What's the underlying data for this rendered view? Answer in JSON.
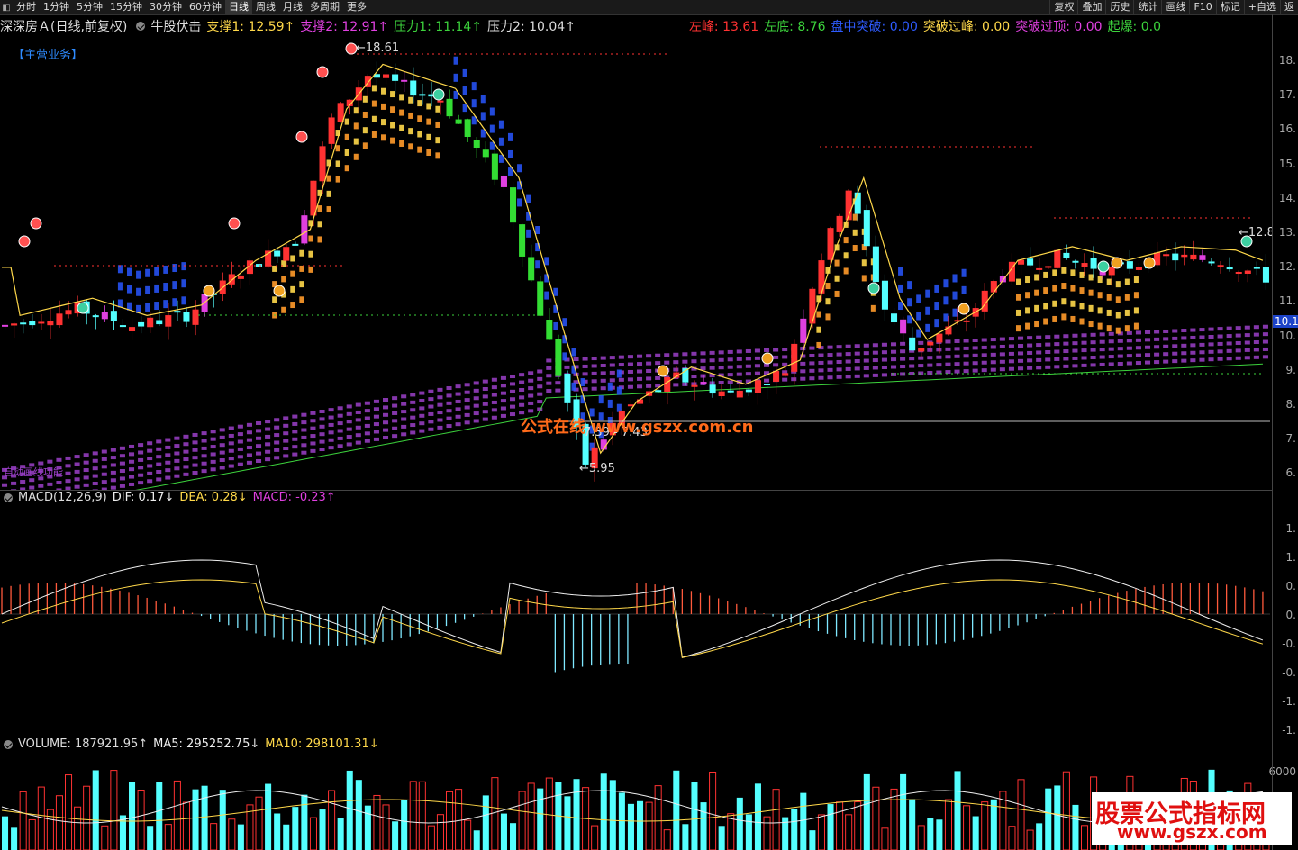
{
  "toolbar": {
    "tabs": [
      "分时",
      "1分钟",
      "5分钟",
      "15分钟",
      "30分钟",
      "60分钟",
      "日线",
      "周线",
      "月线",
      "多周期",
      "更多"
    ],
    "active_tab": "日线",
    "right_buttons": [
      "复权",
      "叠加",
      "历史",
      "统计",
      "画线",
      "F10",
      "标记",
      "+自选",
      "返"
    ]
  },
  "info": {
    "stock": "深深房Ａ(日线,前复权)",
    "indicator": "牛股伏击",
    "support1": "支撑1: 12.59↑",
    "support2": "支撑2: 12.91↑",
    "pressure1": "压力1: 11.14↑",
    "pressure2": "压力2: 10.04↑",
    "left_peak": "左峰: 13.61",
    "left_bottom": "左底: 8.76",
    "intraday_break": "盘中突破: 0.00",
    "break_peak": "突破过峰: 0.00",
    "break_top": "突破过顶: 0.00",
    "burst": "起爆: 0.0"
  },
  "main_business": "【主营业务】",
  "price_axis": [
    "18.",
    "17.",
    "16.",
    "15.",
    "14.",
    "13.",
    "12.",
    "11.",
    "10.",
    "9.",
    "8.",
    "7.",
    "6."
  ],
  "price_tag": "10.1",
  "annotations": {
    "high": "18.61",
    "low": "5.95",
    "range": "7.39 - 7.43",
    "last": "12.8"
  },
  "watermark": "公式在线 www.gszx.com.cn",
  "bottom_left_label": "自动画线功能",
  "macd": {
    "title": "MACD(12,26,9)",
    "dif": "DIF: 0.17↓",
    "dea": "DEA: 0.28↓",
    "macd": "MACD: -0.23↑",
    "axis": [
      "1.",
      "1.",
      "0.",
      "0.",
      "-0.",
      "-0.",
      "-1.",
      "-1."
    ]
  },
  "volume": {
    "title": "VOLUME: 187921.95↑",
    "ma5": "MA5: 295252.75↓",
    "ma10": "MA10: 298101.31↓",
    "axis": [
      "6000"
    ]
  },
  "brand": {
    "title": "股票公式指标网",
    "url": "www.gszx.com"
  },
  "colors": {
    "up": "#ff3232",
    "down": "#54ffff",
    "ribbon": "#9b3fc8",
    "blue_ribbon": "#2856ff",
    "yellow": "#ffd84a",
    "macd_up": "#ff5a3c",
    "macd_down": "#7fe8ff"
  }
}
